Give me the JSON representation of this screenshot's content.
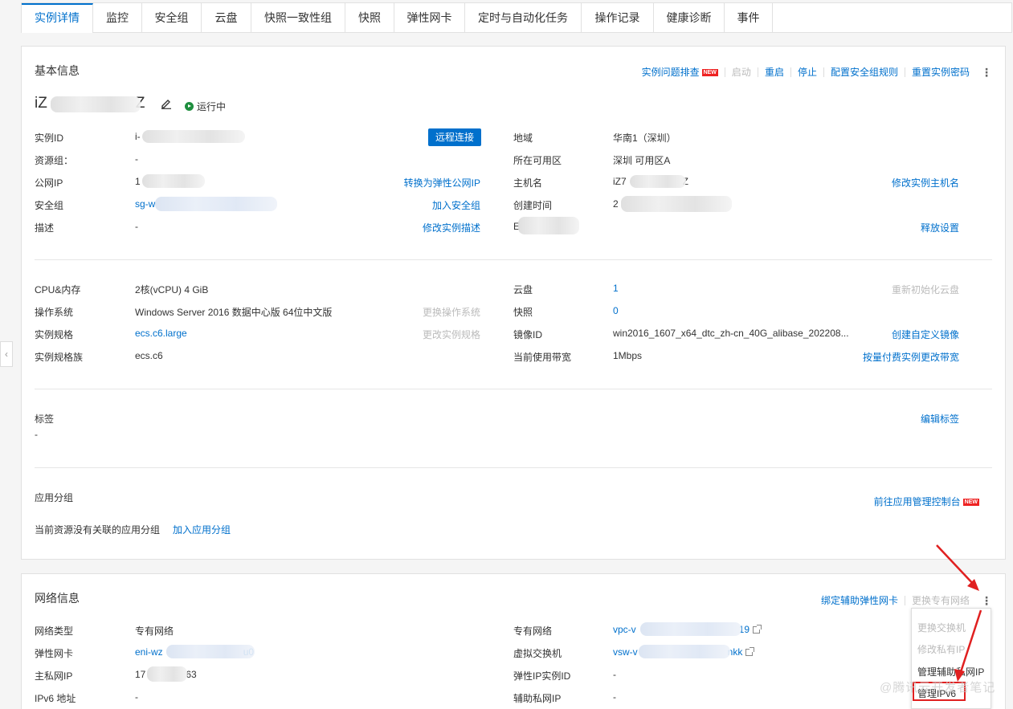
{
  "tabs": [
    "实例详情",
    "监控",
    "安全组",
    "云盘",
    "快照一致性组",
    "快照",
    "弹性网卡",
    "定时与自动化任务",
    "操作记录",
    "健康诊断",
    "事件"
  ],
  "basic": {
    "title": "基本信息",
    "actions": {
      "troubleshoot": "实例问题排查",
      "new": "NEW",
      "start": "启动",
      "restart": "重启",
      "stop": "停止",
      "config_sg": "配置安全组规则",
      "reset_pwd": "重置实例密码",
      "more": "⋮"
    },
    "instance_name_start": "iZ",
    "instance_name_end": "Z",
    "status": "运行中",
    "remote_connect": "远程连接",
    "left": [
      {
        "label": "实例ID",
        "value": "i-"
      },
      {
        "label": "资源组：",
        "value": "-"
      },
      {
        "label": "公网IP",
        "value": "1",
        "action": "转换为弹性公网IP"
      },
      {
        "label": "安全组",
        "value": "sg-w",
        "action": "加入安全组"
      },
      {
        "label": "描述",
        "value": "-",
        "action": "修改实例描述"
      }
    ],
    "right": [
      {
        "label": "地域",
        "value": "华南1（深圳）"
      },
      {
        "label": "所在可用区",
        "value": "深圳 可用区A"
      },
      {
        "label": "主机名",
        "value": "iZ7",
        "value_end": "Z",
        "action": "修改实例主机名"
      },
      {
        "label": "创建时间",
        "value": "2"
      },
      {
        "label": "E",
        "value": "",
        "action": "释放设置"
      }
    ],
    "spec_left": [
      {
        "label": "CPU&内存",
        "value": "2核(vCPU) 4 GiB"
      },
      {
        "label": "操作系统",
        "value": "Windows Server 2016 数据中心版 64位中文版",
        "action": "更换操作系统"
      },
      {
        "label": "实例规格",
        "value": "ecs.c6.large",
        "action": "更改实例规格"
      },
      {
        "label": "实例规格族",
        "value": "ecs.c6"
      }
    ],
    "spec_right": [
      {
        "label": "云盘",
        "value": "1",
        "action": "重新初始化云盘"
      },
      {
        "label": "快照",
        "value": "0"
      },
      {
        "label": "镜像ID",
        "value": "win2016_1607_x64_dtc_zh-cn_40G_alibase_202208...",
        "action": "创建自定义镜像"
      },
      {
        "label": "当前使用带宽",
        "value": "1Mbps",
        "action": "按量付费实例更改带宽"
      }
    ],
    "tags": {
      "label": "标签",
      "value": "-",
      "action": "编辑标签"
    },
    "app_group": {
      "label": "应用分组",
      "action": "前往应用管理控制台",
      "new": "NEW",
      "empty_text": "当前资源没有关联的应用分组",
      "add": "加入应用分组"
    }
  },
  "network": {
    "title": "网络信息",
    "actions": {
      "bind_eni": "绑定辅助弹性网卡",
      "change_vpc": "更换专有网络",
      "more": "⋮"
    },
    "left": [
      {
        "label": "网络类型",
        "value": "专有网络"
      },
      {
        "label": "弹性网卡",
        "value": "eni-wz",
        "value_end": "u0"
      },
      {
        "label": "主私网IP",
        "value": "17",
        "value_end": "63"
      },
      {
        "label": "IPv6 地址",
        "value": "-"
      }
    ],
    "right": [
      {
        "label": "专有网络",
        "value": "vpc-v",
        "value_end": "19"
      },
      {
        "label": "虚拟交换机",
        "value": "vsw-v",
        "value_end": "nkk"
      },
      {
        "label": "弹性IP实例ID",
        "value": "-"
      },
      {
        "label": "辅助私网IP",
        "value": "-"
      }
    ],
    "dropdown": [
      "更换交换机",
      "修改私有IP",
      "管理辅助私网IP",
      "管理IPv6"
    ]
  },
  "watermark": "@腾讯云开发者笔记",
  "colors": {
    "link": "#0070cc",
    "primary": "#0070cc",
    "running": "#1e8e3e",
    "highlight": "#e02020"
  }
}
